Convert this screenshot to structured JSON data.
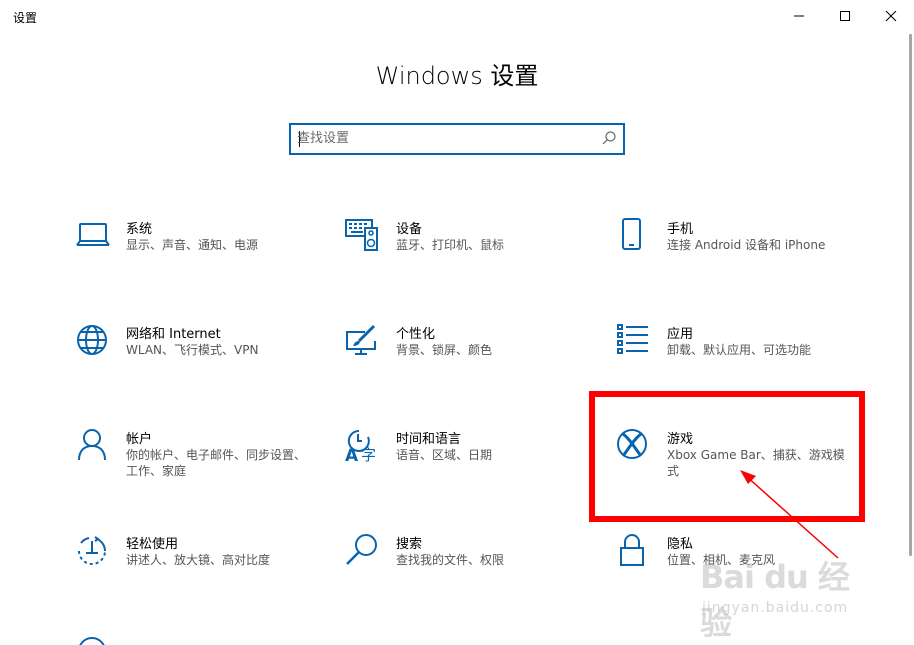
{
  "window": {
    "title": "设置",
    "controls": [
      "minimize-icon",
      "maximize-icon",
      "close-icon"
    ]
  },
  "page_title": "Windows 设置",
  "search": {
    "placeholder": "查找设置",
    "value": "",
    "icon": "search-icon"
  },
  "tiles": [
    {
      "name": "系统",
      "desc": "显示、声音、通知、电源",
      "icon": "laptop-icon"
    },
    {
      "name": "设备",
      "desc": "蓝牙、打印机、鼠标",
      "icon": "keyboard-speaker-icon"
    },
    {
      "name": "手机",
      "desc": "连接 Android 设备和 iPhone",
      "icon": "phone-icon"
    },
    {
      "name": "网络和 Internet",
      "desc": "WLAN、飞行模式、VPN",
      "icon": "globe-icon"
    },
    {
      "name": "个性化",
      "desc": "背景、锁屏、颜色",
      "icon": "paint-monitor-icon"
    },
    {
      "name": "应用",
      "desc": "卸载、默认应用、可选功能",
      "icon": "apps-list-icon"
    },
    {
      "name": "帐户",
      "desc": "你的帐户、电子邮件、同步设置、工作、家庭",
      "icon": "person-icon"
    },
    {
      "name": "时间和语言",
      "desc": "语音、区域、日期",
      "icon": "time-language-icon"
    },
    {
      "name": "游戏",
      "desc": "Xbox Game Bar、捕获、游戏模式",
      "icon": "xbox-icon"
    },
    {
      "name": "轻松使用",
      "desc": "讲述人、放大镜、高对比度",
      "icon": "ease-of-access-icon"
    },
    {
      "name": "搜索",
      "desc": "查找我的文件、权限",
      "icon": "magnifier-icon"
    },
    {
      "name": "隐私",
      "desc": "位置、相机、麦克风",
      "icon": "lock-icon"
    }
  ],
  "highlight": {
    "target": "游戏",
    "color": "#ff0000"
  },
  "accent_color": "#0a64ad",
  "watermark": {
    "logo": "Bai du 经验",
    "url": "jingyan.baidu.com"
  }
}
